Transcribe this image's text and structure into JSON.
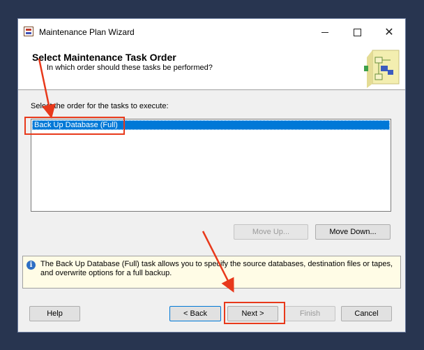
{
  "window": {
    "title": "Maintenance Plan Wizard",
    "controls": {
      "minimize": "minimize",
      "maximize": "maximize",
      "close": "✕"
    }
  },
  "header": {
    "title": "Select Maintenance Task Order",
    "subtitle": "In which order should these tasks be performed?"
  },
  "main": {
    "instruction": "Select the order for the tasks to execute:",
    "tasks": [
      {
        "label": "Back Up Database (Full)",
        "selected": true
      }
    ],
    "move_up_label": "Move Up...",
    "move_down_label": "Move Down..."
  },
  "info": {
    "text": "The Back Up Database (Full) task allows you to specify the source databases, destination files or tapes, and overwrite options for a full backup."
  },
  "footer": {
    "help_label": "Help",
    "back_label": "< Back",
    "next_label": "Next >",
    "finish_label": "Finish",
    "cancel_label": "Cancel"
  },
  "colors": {
    "desktop_bg": "#283550",
    "selection": "#0078d7",
    "annotation": "#e8391b"
  },
  "icons": {
    "app": "maintenance-plan-icon",
    "header": "wizard-graphic-icon",
    "info": "info-icon"
  }
}
